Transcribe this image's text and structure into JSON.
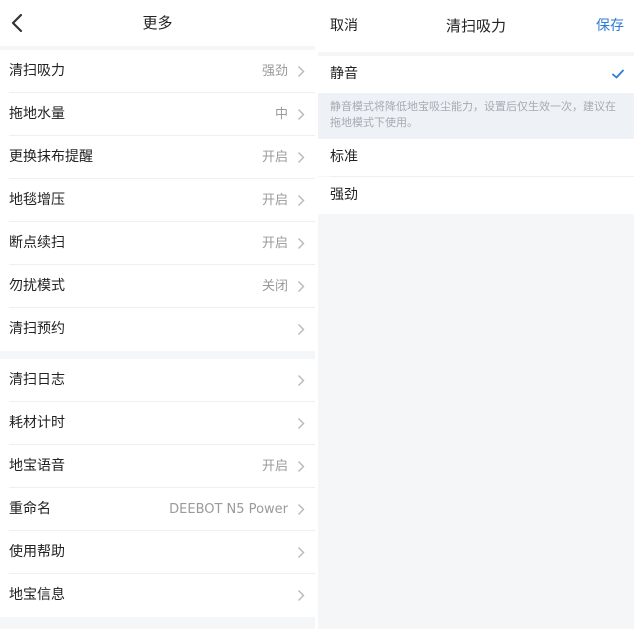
{
  "left": {
    "title": "更多",
    "groups": [
      {
        "items": [
          {
            "label": "清扫吸力",
            "value": "强劲"
          },
          {
            "label": "拖地水量",
            "value": "中"
          },
          {
            "label": "更换抹布提醒",
            "value": "开启"
          },
          {
            "label": "地毯增压",
            "value": "开启"
          },
          {
            "label": "断点续扫",
            "value": "开启"
          },
          {
            "label": "勿扰模式",
            "value": "关闭"
          },
          {
            "label": "清扫预约",
            "value": ""
          }
        ]
      },
      {
        "items": [
          {
            "label": "清扫日志",
            "value": ""
          },
          {
            "label": "耗材计时",
            "value": ""
          },
          {
            "label": "地宝语音",
            "value": "开启"
          },
          {
            "label": "重命名",
            "value": "DEEBOT N5 Power"
          },
          {
            "label": "使用帮助",
            "value": ""
          },
          {
            "label": "地宝信息",
            "value": ""
          }
        ]
      }
    ]
  },
  "right": {
    "cancel_label": "取消",
    "title": "清扫吸力",
    "save_label": "保存",
    "options": [
      {
        "label": "静音",
        "selected": true,
        "description": "静音模式将降低地宝吸尘能力，设置后仅生效一次，建议在拖地模式下使用。"
      },
      {
        "label": "标准",
        "selected": false
      },
      {
        "label": "强劲",
        "selected": false
      }
    ]
  },
  "colors": {
    "accent": "#2f7bd6",
    "background": "#f5f6f8",
    "secondary_text": "#9a9a9a"
  },
  "icons": {
    "back": "chevron-left-icon",
    "row_arrow": "chevron-right-icon",
    "selected": "checkmark-icon"
  }
}
